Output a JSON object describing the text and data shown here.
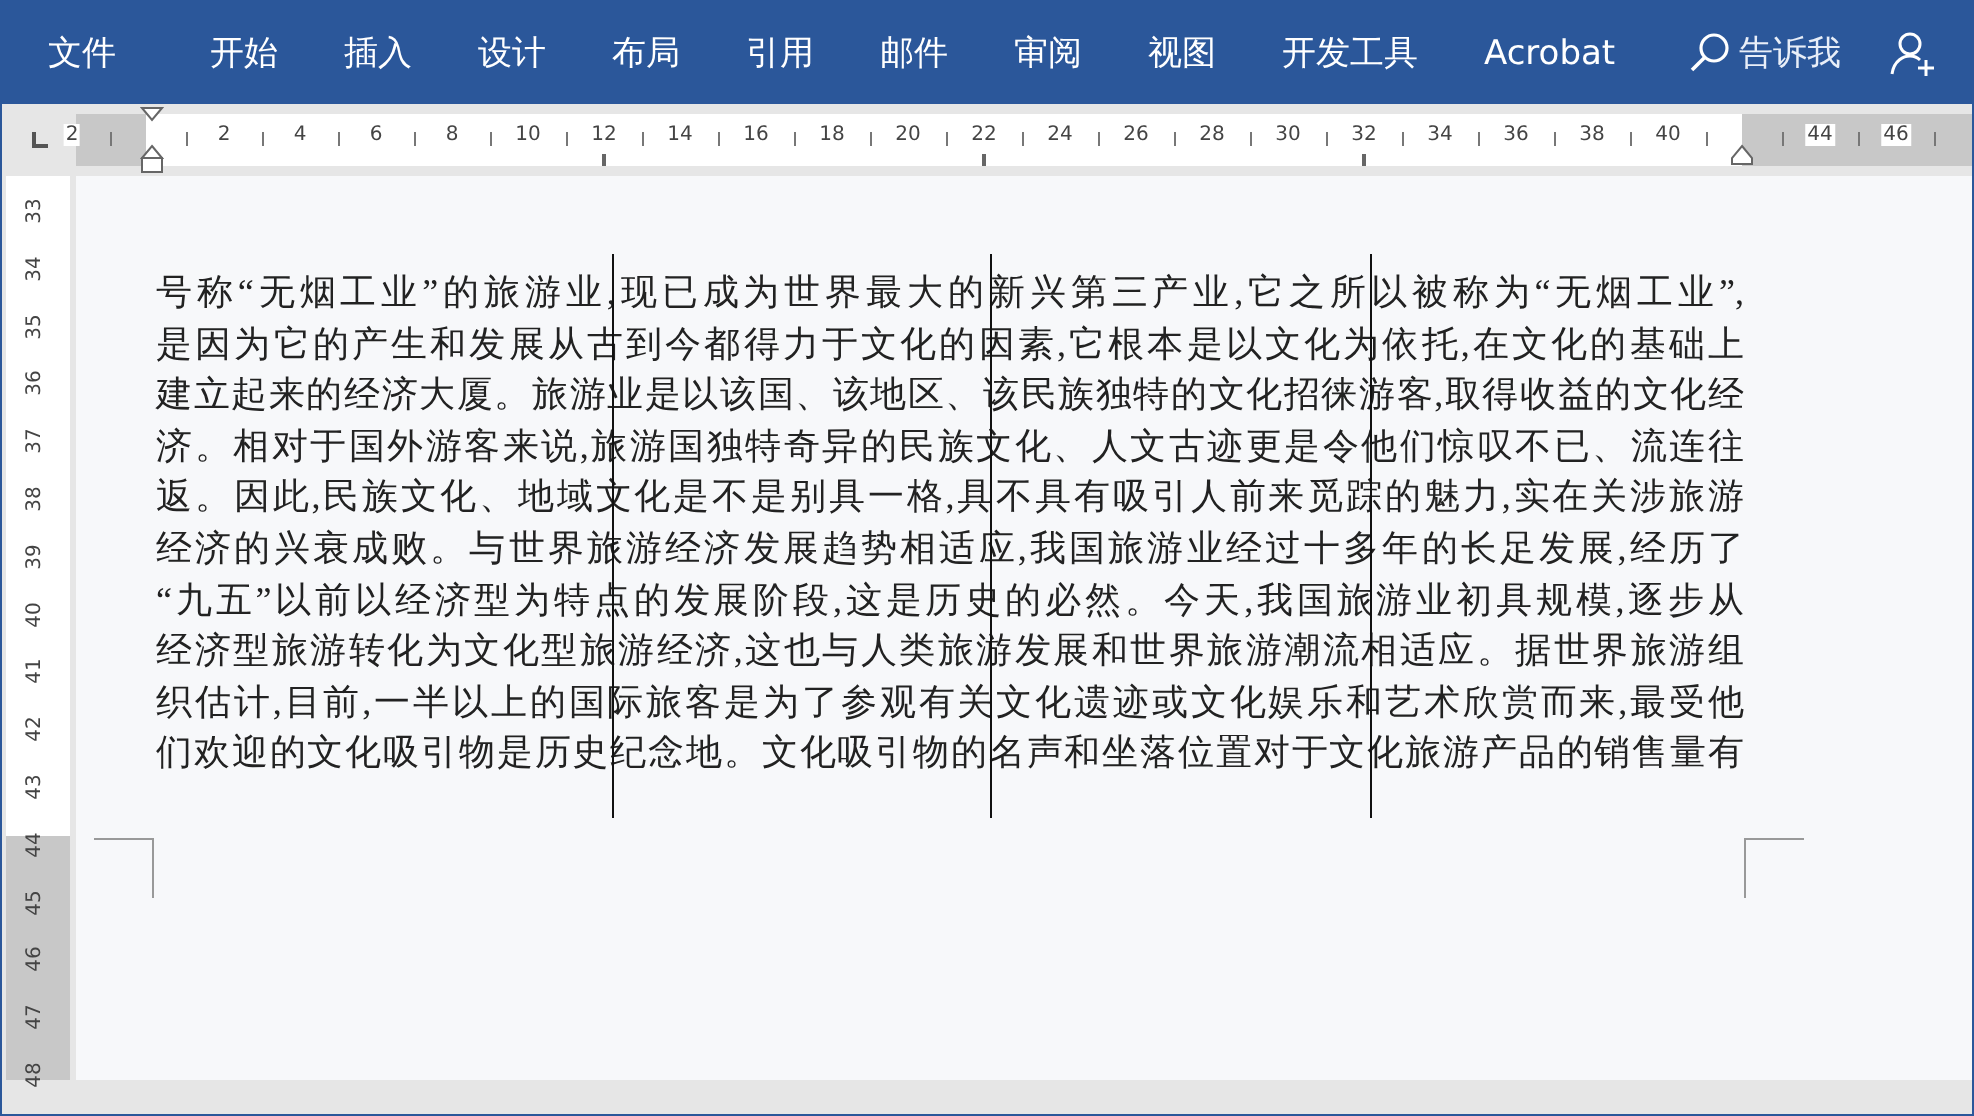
{
  "ribbon": {
    "tabs": [
      {
        "label": "文件"
      },
      {
        "label": "开始"
      },
      {
        "label": "插入"
      },
      {
        "label": "设计"
      },
      {
        "label": "布局"
      },
      {
        "label": "引用"
      },
      {
        "label": "邮件"
      },
      {
        "label": "审阅"
      },
      {
        "label": "视图"
      },
      {
        "label": "开发工具"
      },
      {
        "label": "Acrobat"
      }
    ],
    "tell_me": "告诉我"
  },
  "ruler": {
    "labels": [
      "2",
      "2",
      "4",
      "6",
      "8",
      "10",
      "12",
      "14",
      "16",
      "18",
      "20",
      "22",
      "24",
      "26",
      "28",
      "30",
      "32",
      "34",
      "36",
      "38",
      "40",
      "44",
      "46"
    ]
  },
  "vertical_ruler": {
    "labels": [
      "33",
      "34",
      "35",
      "36",
      "37",
      "38",
      "39",
      "40",
      "41",
      "42",
      "43",
      "44",
      "45",
      "46",
      "47",
      "48"
    ]
  },
  "document": {
    "paragraph_lines": [
      "号称“无烟工业”的旅游业,现已成为世界最大的新兴第三产业,它之所以被称为“无烟工业”,",
      "是因为它的产生和发展从古到今都得力于文化的因素,它根本是以文化为依托,在文化的基础上",
      "建立起来的经济大厦。旅游业是以该国、该地区、该民族独特的文化招徕游客,取得收益的文化经",
      "济。相对于国外游客来说,旅游国独特奇异的民族文化、人文古迹更是令他们惊叹不已、流连往",
      "返。因此,民族文化、地域文化是不是别具一格,具不具有吸引人前来觅踪的魅力,实在关涉旅游",
      "经济的兴衰成败。与世界旅游经济发展趋势相适应,我国旅游业经过十多年的长足发展,经历了",
      "“九五”以前以经济型为特点的发展阶段,这是历史的必然。今天,我国旅游业初具规模,逐步从",
      "经济型旅游转化为文化型旅游经济,这也与人类旅游发展和世界旅游潮流相适应。据世界旅游组",
      "织估计,目前,一半以上的国际旅客是为了参观有关文化遗迹或文化娱乐和艺术欣赏而来,最受他",
      "们欢迎的文化吸引物是历史纪念地。文化吸引物的名声和坐落位置对于文化旅游产品的销售量有"
    ]
  }
}
